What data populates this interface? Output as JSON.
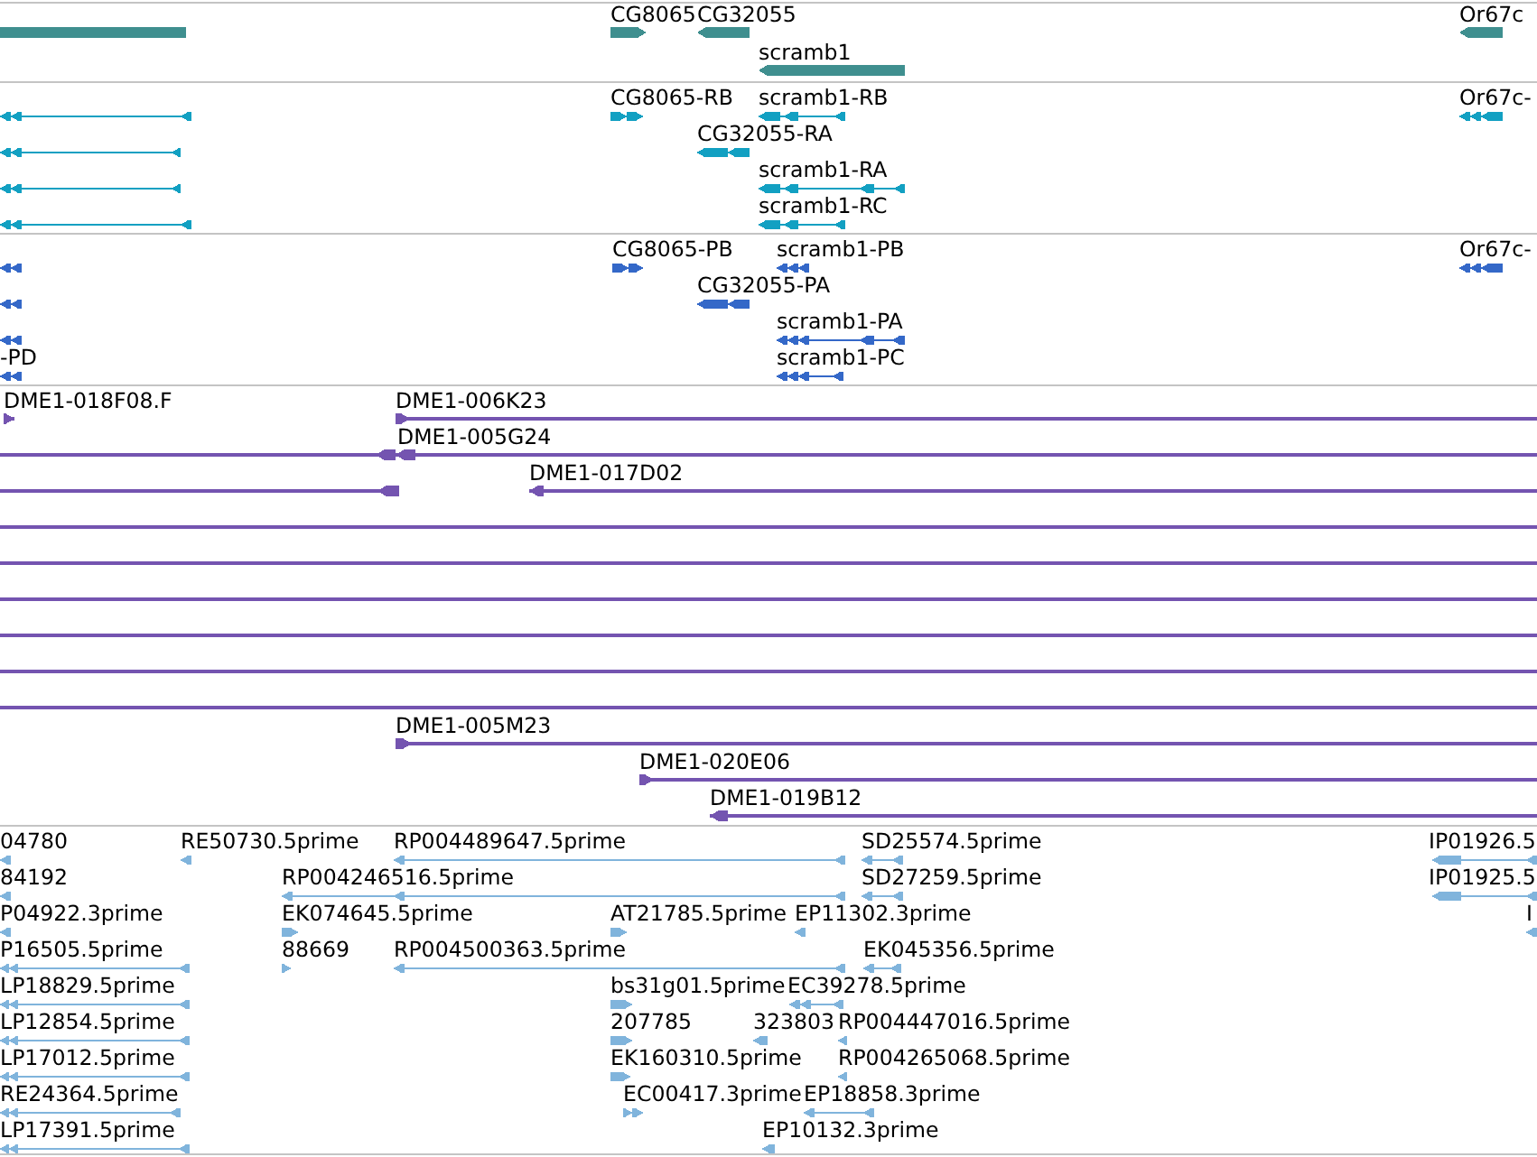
{
  "tracks": [
    {
      "kind": "gene",
      "color": "#3f8f8f",
      "features": [
        {
          "kind": "bar"
        },
        {
          "kind": "arrow",
          "label": "CG8065",
          "reverse": false
        },
        {
          "kind": "arrow",
          "label": "CG32055",
          "reverse": true
        },
        {
          "kind": "arrow",
          "label": "Or67c",
          "reverse": true
        },
        {
          "kind": "arrow",
          "label": "scramb1",
          "reverse": true
        }
      ]
    },
    {
      "kind": "transcript",
      "color": "#12a0c2",
      "features": [
        {
          "reverse": true
        },
        {
          "label": "CG8065-RB",
          "reverse": false
        },
        {
          "label": "scramb1-RB",
          "reverse": true
        },
        {
          "label": "Or67c-",
          "reverse": true
        },
        {
          "reverse": true
        },
        {
          "label": "CG32055-RA",
          "reverse": true
        },
        {
          "reverse": true
        },
        {
          "label": "scramb1-RA",
          "reverse": true
        },
        {
          "reverse": true
        },
        {
          "label": "scramb1-RC",
          "reverse": true
        }
      ]
    },
    {
      "kind": "protein",
      "color": "#3468c8",
      "features": [
        {
          "reverse": true
        },
        {
          "label": "CG8065-PB",
          "reverse": false
        },
        {
          "label": "scramb1-PB",
          "reverse": true
        },
        {
          "label": "Or67c-",
          "reverse": true
        },
        {
          "reverse": true
        },
        {
          "label": "CG32055-PA",
          "reverse": true
        },
        {
          "reverse": true
        },
        {
          "label": "scramb1-PA",
          "reverse": true
        },
        {
          "label": "-PD",
          "reverse": true
        },
        {
          "label": "scramb1-PC",
          "reverse": true
        }
      ]
    },
    {
      "kind": "clone",
      "color": "#7454b0",
      "features": [
        {
          "kind": "arrow",
          "label": "DME1-018F08.F",
          "reverse": false
        },
        {
          "kind": "arrow",
          "label": "DME1-006K23",
          "reverse": false
        },
        {
          "kind": "arrow",
          "label": "DME1-005G24",
          "reverse": true
        },
        {
          "kind": "arrow",
          "reverse": true
        },
        {
          "kind": "arrow",
          "label": "DME1-017D02",
          "reverse": true
        },
        {
          "kind": "line"
        },
        {
          "kind": "line"
        },
        {
          "kind": "line"
        },
        {
          "kind": "line"
        },
        {
          "kind": "line"
        },
        {
          "kind": "line"
        },
        {
          "kind": "arrow",
          "label": "DME1-005M23",
          "reverse": false
        },
        {
          "kind": "arrow",
          "label": "DME1-020E06",
          "reverse": false
        },
        {
          "kind": "arrow",
          "label": "DME1-019B12",
          "reverse": true
        }
      ]
    },
    {
      "kind": "est",
      "color": "#80b4dc",
      "features": [
        {
          "label": "04780",
          "reverse": true
        },
        {
          "label": "RE50730.5prime",
          "reverse": true
        },
        {
          "label": "RP004489647.5prime",
          "reverse": true
        },
        {
          "label": "SD25574.5prime",
          "reverse": true
        },
        {
          "label": "IP01926.5",
          "reverse": true
        },
        {
          "label": "84192",
          "reverse": true
        },
        {
          "label": "RP004246516.5prime",
          "reverse": true
        },
        {
          "label": "SD27259.5prime",
          "reverse": true
        },
        {
          "label": "IP01925.5",
          "reverse": true
        },
        {
          "label": "P04922.3prime",
          "reverse": true
        },
        {
          "label": "EK074645.5prime",
          "reverse": false
        },
        {
          "label": "AT21785.5prime",
          "reverse": false
        },
        {
          "label": "EP11302.3prime",
          "reverse": true
        },
        {
          "label": "I",
          "reverse": true
        },
        {
          "label": "P16505.5prime",
          "reverse": true
        },
        {
          "label": "88669",
          "reverse": false
        },
        {
          "label": "RP004500363.5prime",
          "reverse": true
        },
        {
          "label": "EK045356.5prime",
          "reverse": true
        },
        {
          "label": "LP18829.5prime",
          "reverse": true
        },
        {
          "label": "bs31g01.5prime",
          "reverse": false
        },
        {
          "label": "EC39278.5prime",
          "reverse": true
        },
        {
          "label": "LP12854.5prime",
          "reverse": true
        },
        {
          "label": "207785",
          "reverse": false
        },
        {
          "label": "323803",
          "reverse": true
        },
        {
          "label": "RP004447016.5prime",
          "reverse": true
        },
        {
          "label": "LP17012.5prime",
          "reverse": true
        },
        {
          "label": "EK160310.5prime",
          "reverse": false
        },
        {
          "label": "RP004265068.5prime",
          "reverse": true
        },
        {
          "label": "RE24364.5prime",
          "reverse": true
        },
        {
          "label": "EC00417.3prime",
          "reverse": false
        },
        {
          "label": "EP18858.3prime",
          "reverse": true
        },
        {
          "label": "LP17391.5prime",
          "reverse": true
        },
        {
          "label": "EP10132.3prime",
          "reverse": true
        }
      ]
    }
  ]
}
